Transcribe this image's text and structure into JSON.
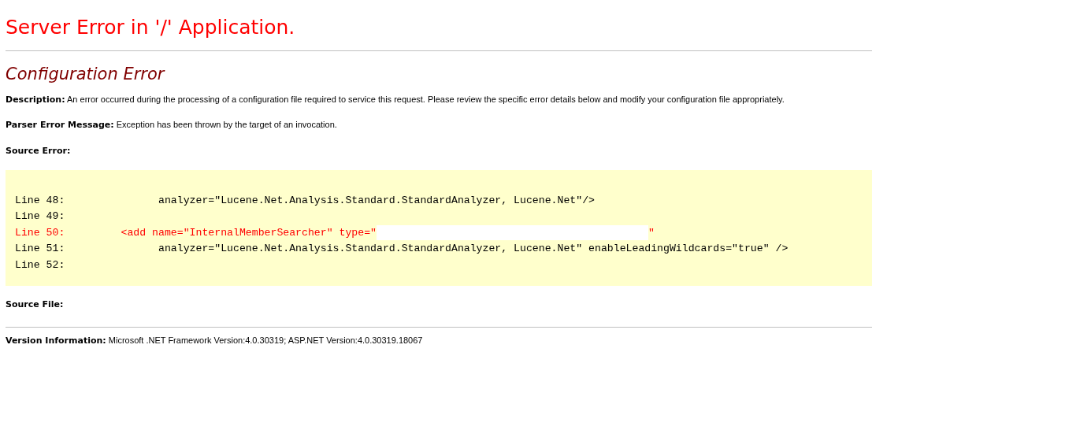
{
  "title": "Server Error in '/' Application.",
  "error_title": "Configuration Error",
  "description": {
    "label": "Description:",
    "text": "An error occurred during the processing of a configuration file required to service this request. Please review the specific error details below and modify your configuration file appropriately."
  },
  "parser_error": {
    "label": "Parser Error Message:",
    "text": "Exception has been thrown by the target of an invocation."
  },
  "source_error": {
    "label": "Source Error:",
    "lines": [
      {
        "text": "Line 48:               analyzer=\"Lucene.Net.Analysis.Standard.StandardAnalyzer, Lucene.Net\"/>",
        "highlighted": false
      },
      {
        "text": "Line 49:",
        "highlighted": false
      },
      {
        "text": "Line 50:         <add name=\"InternalMemberSearcher\" type=\"",
        "text_after": "\"",
        "redacted": true,
        "highlighted": true
      },
      {
        "text": "Line 51:               analyzer=\"Lucene.Net.Analysis.Standard.StandardAnalyzer, Lucene.Net\" enableLeadingWildcards=\"true\" />",
        "highlighted": false
      },
      {
        "text": "Line 52:",
        "highlighted": false
      }
    ]
  },
  "source_file": {
    "label": "Source File:"
  },
  "version": {
    "label": "Version Information:",
    "text": "Microsoft .NET Framework Version:4.0.30319; ASP.NET Version:4.0.30319.18067"
  }
}
